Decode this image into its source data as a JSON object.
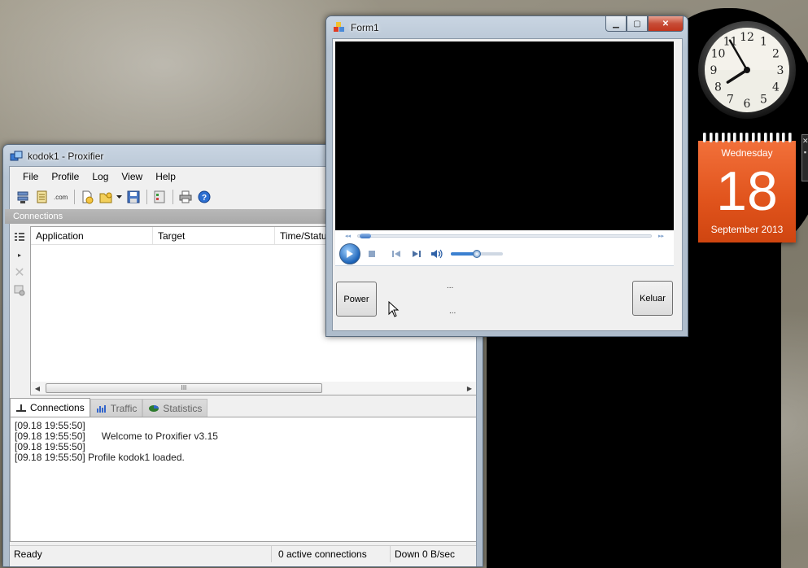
{
  "proxifier": {
    "title": "kodok1 - Proxifier",
    "menu": [
      "File",
      "Profile",
      "Log",
      "View",
      "Help"
    ],
    "section_label": "Connections",
    "columns": [
      "Application",
      "Target",
      "Time/Status"
    ],
    "tabs": [
      {
        "label": "Connections",
        "active": true
      },
      {
        "label": "Traffic",
        "active": false
      },
      {
        "label": "Statistics",
        "active": false
      }
    ],
    "log": [
      "[09.18 19:55:50]",
      "[09.18 19:55:50]      Welcome to Proxifier v3.15",
      "[09.18 19:55:50]",
      "[09.18 19:55:50] Profile kodok1 loaded."
    ],
    "status": {
      "left": "Ready",
      "connections": "0 active connections",
      "down": "Down 0 B/sec"
    },
    "scroll_thumb": "III"
  },
  "form1": {
    "title": "Form1",
    "power_button": "Power",
    "exit_button": "Keluar",
    "label1": "...",
    "label2": "...",
    "volume_level": 0.5
  },
  "calendar": {
    "weekday": "Wednesday",
    "day": "18",
    "month_year": "September 2013"
  },
  "clock": {
    "numerals": [
      "12",
      "1",
      "2",
      "3",
      "4",
      "5",
      "6",
      "7",
      "8",
      "9",
      "10",
      "11"
    ],
    "hour": 7,
    "minute": 55
  }
}
